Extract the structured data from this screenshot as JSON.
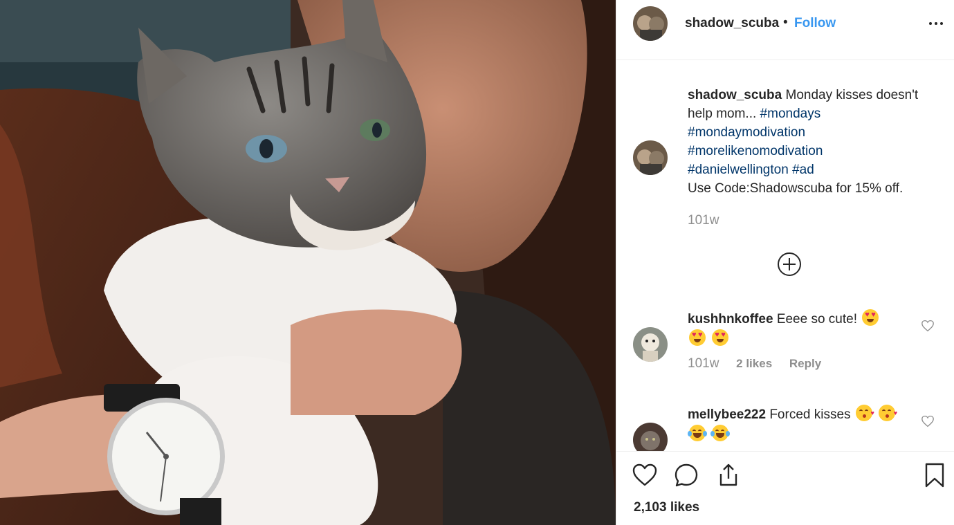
{
  "post": {
    "username": "shadow_scuba",
    "separator": "•",
    "follow_label": "Follow",
    "more_icon": "more-horizontal-icon"
  },
  "caption": {
    "username": "shadow_scuba",
    "text": "Monday kisses doesn't help mom...",
    "hashtags": [
      "#mondays",
      "#mondaymodivation",
      "#morelikenomodivation",
      "#danielwellington",
      "#ad"
    ],
    "promo": "Use Code:Shadowscuba for 15% off.",
    "timestamp": "101w"
  },
  "comments": [
    {
      "username": "kushhnkoffee",
      "text": "Eeee so cute!",
      "emoji": "heart-eyes-cat",
      "timestamp": "101w",
      "likes": "2 likes",
      "reply_label": "Reply"
    },
    {
      "username": "mellybee222",
      "text": "Forced kisses",
      "emoji": "kissing-face laughing-tears",
      "timestamp": "",
      "likes": "",
      "reply_label": ""
    }
  ],
  "likes_total": "2,103 likes",
  "colors": {
    "link": "#3897f0",
    "hashtag": "#003569",
    "muted": "#8e8e8e",
    "text": "#262626"
  }
}
